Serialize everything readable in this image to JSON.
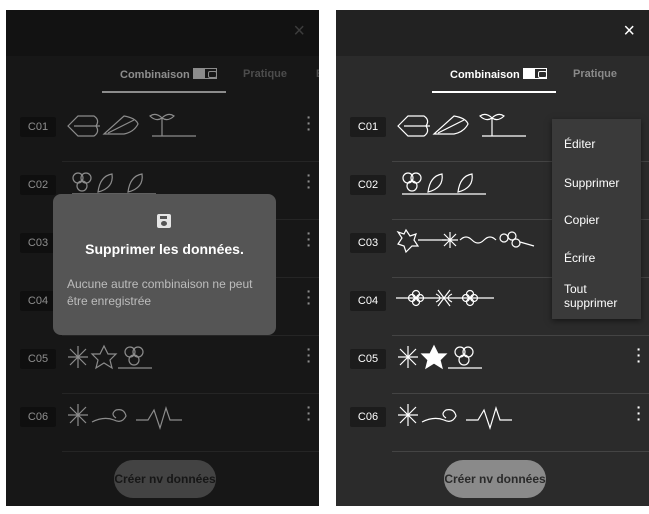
{
  "left": {
    "close": "×",
    "tabs": {
      "combinaison": "Combinaison",
      "pratique": "Pratique",
      "third": "B"
    },
    "rows": [
      "C01",
      "C02",
      "C03",
      "C04",
      "C05",
      "C06"
    ],
    "create_button": "Créer nv données",
    "dialog": {
      "icon": "save-icon",
      "title": "Supprimer les données.",
      "message": "Aucune autre combinaison ne peut être enregistrée"
    }
  },
  "right": {
    "close": "×",
    "tabs": {
      "combinaison": "Combinaison",
      "pratique": "Pratique"
    },
    "rows": [
      "C01",
      "C02",
      "C03",
      "C04",
      "C05",
      "C06"
    ],
    "create_button": "Créer nv données",
    "menu": [
      "Éditer",
      "Supprimer",
      "Copier",
      "Écrire",
      "Tout supprimer"
    ]
  }
}
